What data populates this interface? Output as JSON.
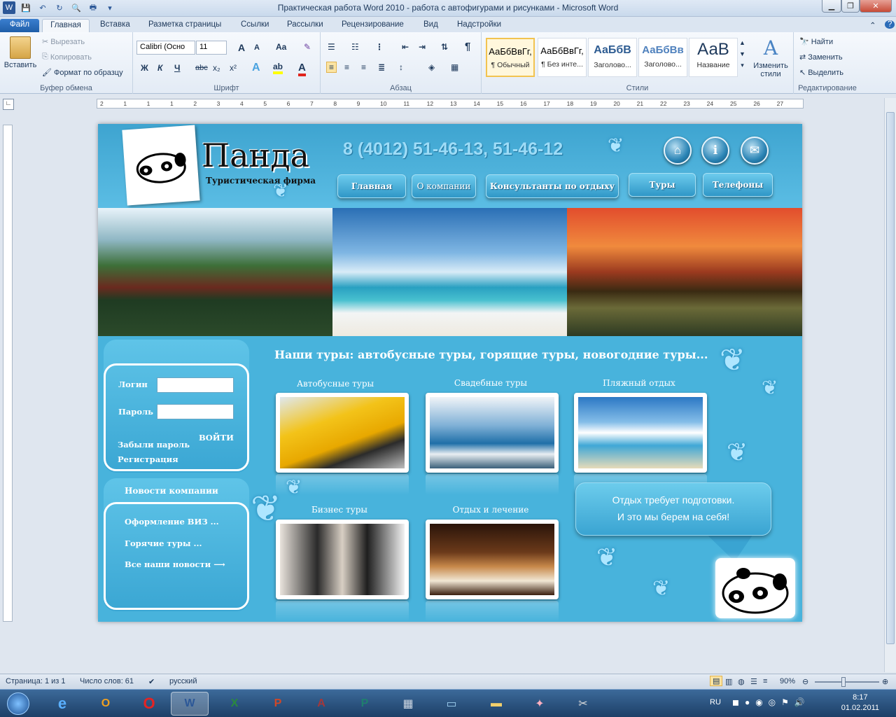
{
  "window": {
    "title": "Практическая работа Word 2010 - работа с автофигурами и рисунками  -  Microsoft Word"
  },
  "ribbon_tabs": [
    "Файл",
    "Главная",
    "Вставка",
    "Разметка страницы",
    "Ссылки",
    "Рассылки",
    "Рецензирование",
    "Вид",
    "Надстройки"
  ],
  "ribbon": {
    "clipboard": {
      "paste": "Вставить",
      "cut": "Вырезать",
      "copy": "Копировать",
      "format_painter": "Формат по образцу",
      "label": "Буфер обмена"
    },
    "font": {
      "name": "Calibri (Осно",
      "size": "11",
      "label": "Шрифт",
      "bold": "Ж",
      "italic": "К",
      "underline": "Ч",
      "strike": "abc",
      "sub": "x₂",
      "sup": "x²",
      "grow": "A",
      "shrink": "A",
      "case": "Aa"
    },
    "paragraph": {
      "label": "Абзац"
    },
    "styles": {
      "label": "Стили",
      "items": [
        {
          "sample": "АаБбВвГг,",
          "name": "¶ Обычный"
        },
        {
          "sample": "АаБбВвГг,",
          "name": "¶ Без инте..."
        },
        {
          "sample": "АаБбВ",
          "name": "Заголово..."
        },
        {
          "sample": "АаБбВв",
          "name": "Заголово..."
        },
        {
          "sample": "АаВ",
          "name": "Название"
        }
      ],
      "change": "Изменить стили"
    },
    "editing": {
      "find": "Найти",
      "replace": "Заменить",
      "select": "Выделить",
      "label": "Редактирование"
    }
  },
  "ruler": {
    "marks": [
      "2",
      "1",
      "1",
      "1",
      "2",
      "3",
      "4",
      "5",
      "6",
      "7",
      "8",
      "9",
      "10",
      "11",
      "12",
      "13",
      "14",
      "15",
      "16",
      "17",
      "18",
      "19",
      "20",
      "21",
      "22",
      "23",
      "24",
      "25",
      "26",
      "27"
    ]
  },
  "site": {
    "logo_title": "Панда",
    "logo_subtitle": "Туристическая  фирма",
    "phone": "8 (4012) 51-46-13, 51-46-12",
    "nav": [
      "Главная",
      "О компании",
      "Консультанты по отдыху",
      "Туры",
      "Телефоны"
    ],
    "login": {
      "login_label": "Логин",
      "password_label": "Пароль",
      "submit": "ВОЙТИ",
      "forgot": "Забыли пароль",
      "register": "Регистрация"
    },
    "news": {
      "title": "Новости компании",
      "items": [
        "Оформление ВИЗ ...",
        "Горячие туры ...",
        "Все наши новости  ⟶"
      ]
    },
    "tours_heading": "Наши туры: автобусные туры, горящие туры, новогодние туры...",
    "tours": [
      {
        "label": "Автобусные туры"
      },
      {
        "label": "Свадебные туры"
      },
      {
        "label": "Пляжный отдых"
      },
      {
        "label": "Бизнес  туры"
      },
      {
        "label": "Отдых и лечение"
      }
    ],
    "bubble": [
      "Отдых требует подготовки.",
      "И это мы берем на себя!"
    ]
  },
  "status": {
    "page": "Страница: 1 из 1",
    "words": "Число слов: 61",
    "language": "русский",
    "zoom": "90%"
  },
  "taskbar": {
    "lang": "RU",
    "time": "8:17",
    "date": "01.02.2011"
  },
  "colors": {
    "page_bg": "#48b3dc",
    "ribbon_file": "#1f5ea8",
    "taskbar": "#1d3f67"
  }
}
